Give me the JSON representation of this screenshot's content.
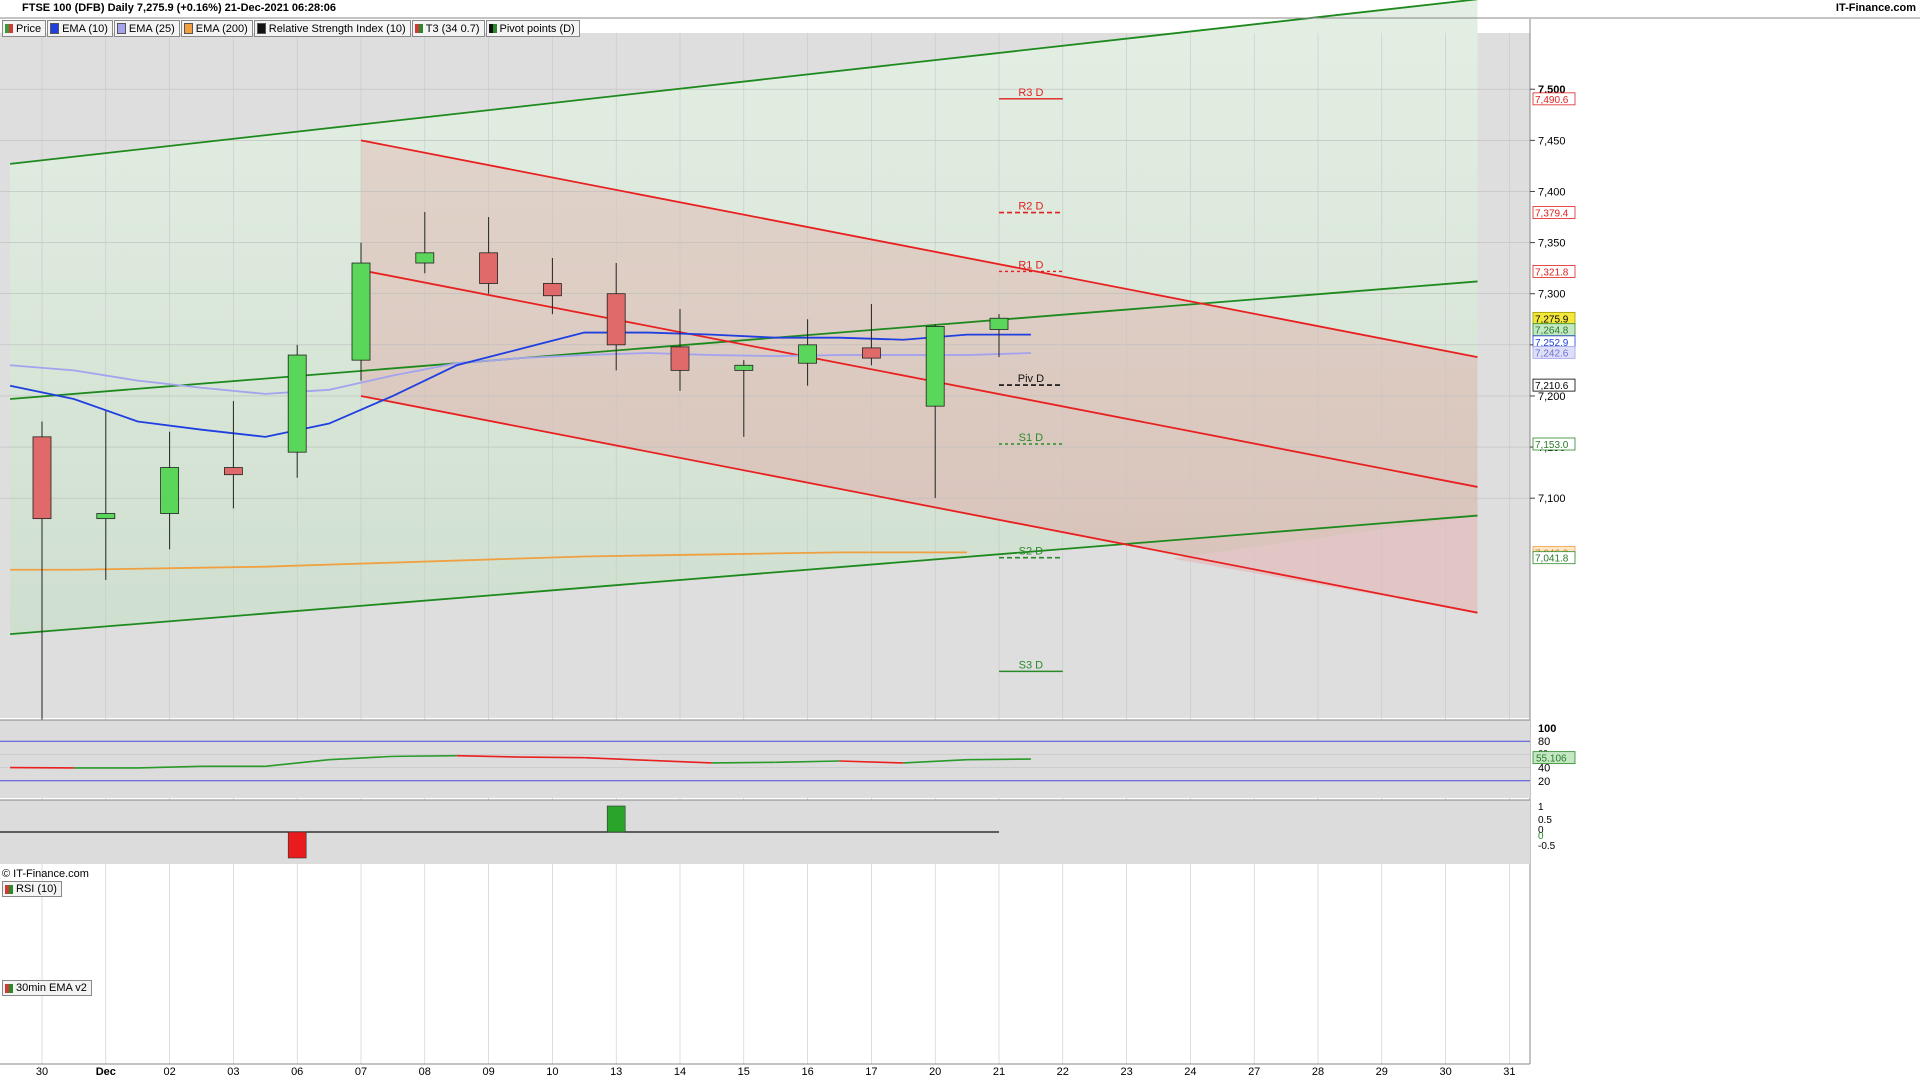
{
  "header": {
    "title": "FTSE 100 (DFB) Daily 7,275.9 (+0.16%) 21-Dec-2021 06:28:06",
    "brand": "IT-Finance.com"
  },
  "legend": [
    {
      "label": "Price",
      "color": "#3a9a3a",
      "color2": "#d23a3a"
    },
    {
      "label": "EMA (10)",
      "color": "#1f3fe0"
    },
    {
      "label": "EMA (25)",
      "color": "#a3a3ee"
    },
    {
      "label": "EMA (200)",
      "color": "#f0a040"
    },
    {
      "label": "Relative Strength Index (10)",
      "color": "#111111"
    },
    {
      "label": "T3 (34 0.7)",
      "color": "#d23a3a",
      "color2": "#2a8a2a"
    },
    {
      "label": "Pivot points (D)",
      "color": "#111111",
      "color2": "#2a8a2a"
    }
  ],
  "copyright": "© IT-Finance.com",
  "rsi_pane_label": "RSI (10)",
  "ema_pane_label": "30min EMA v2",
  "chart_data": {
    "type": "candlestick",
    "dates": [
      "30",
      "Dec",
      "02",
      "03",
      "06",
      "07",
      "08",
      "09",
      "10",
      "13",
      "14",
      "15",
      "16",
      "17",
      "20",
      "21",
      "22",
      "23",
      "24",
      "27",
      "28",
      "29",
      "30",
      "31"
    ],
    "candles": [
      {
        "date": "30",
        "open": 7160,
        "high": 7175,
        "low": 6860,
        "close": 7080
      },
      {
        "date": "Dec",
        "open": 7080,
        "high": 7185,
        "low": 7020,
        "close": 7085
      },
      {
        "date": "02",
        "open": 7085,
        "high": 7165,
        "low": 7050,
        "close": 7130
      },
      {
        "date": "03",
        "open": 7130,
        "high": 7195,
        "low": 7090,
        "close": 7123
      },
      {
        "date": "06",
        "open": 7145,
        "high": 7250,
        "low": 7120,
        "close": 7240
      },
      {
        "date": "07",
        "open": 7235,
        "high": 7350,
        "low": 7215,
        "close": 7330
      },
      {
        "date": "08",
        "open": 7330,
        "high": 7380,
        "low": 7320,
        "close": 7340
      },
      {
        "date": "09",
        "open": 7340,
        "high": 7375,
        "low": 7300,
        "close": 7310
      },
      {
        "date": "10",
        "open": 7310,
        "high": 7335,
        "low": 7280,
        "close": 7298
      },
      {
        "date": "13",
        "open": 7300,
        "high": 7330,
        "low": 7225,
        "close": 7250
      },
      {
        "date": "14",
        "open": 7248,
        "high": 7285,
        "low": 7205,
        "close": 7225
      },
      {
        "date": "15",
        "open": 7225,
        "high": 7235,
        "low": 7160,
        "close": 7230
      },
      {
        "date": "16",
        "open": 7232,
        "high": 7275,
        "low": 7210,
        "close": 7250
      },
      {
        "date": "17",
        "open": 7247,
        "high": 7290,
        "low": 7230,
        "close": 7237
      },
      {
        "date": "20",
        "open": 7190,
        "high": 7270,
        "low": 7100,
        "close": 7268
      },
      {
        "date": "21",
        "open": 7265,
        "high": 7280,
        "low": 7238,
        "close": 7276
      }
    ],
    "ema10": [
      7210,
      7197,
      7175,
      7167,
      7160,
      7173,
      7200,
      7230,
      7246,
      7262,
      7262,
      7260,
      7257,
      7257,
      7255,
      7260,
      7260
    ],
    "ema25": [
      7230,
      7225,
      7215,
      7208,
      7202,
      7206,
      7220,
      7232,
      7237,
      7240,
      7242,
      7240,
      7239,
      7240,
      7240,
      7240,
      7242
    ],
    "ema200": [
      7030,
      7030,
      7031,
      7032,
      7033,
      7035,
      7037,
      7039,
      7041,
      7043,
      7044,
      7045,
      7046,
      7047,
      7047,
      7047
    ],
    "channels": {
      "green_upper": [
        [
          -0.5,
          7427
        ],
        [
          22.5,
          7588
        ]
      ],
      "green_mid": [
        [
          -0.5,
          7197
        ],
        [
          22.5,
          7312
        ]
      ],
      "green_lower": [
        [
          -0.5,
          6967
        ],
        [
          22.5,
          7083
        ]
      ],
      "red_upper": [
        [
          5,
          7450
        ],
        [
          22.5,
          7238
        ]
      ],
      "red_mid": [
        [
          5,
          7323
        ],
        [
          22.5,
          7111
        ]
      ],
      "red_lower": [
        [
          5,
          7200
        ],
        [
          22.5,
          6988
        ]
      ]
    },
    "pivots": [
      {
        "label": "R3 D",
        "value": 7490.6,
        "color": "#e02020",
        "style": "solid"
      },
      {
        "label": "R2 D",
        "value": 7379.4,
        "color": "#e02020",
        "style": "dashed"
      },
      {
        "label": "R1 D",
        "value": 7321.8,
        "color": "#e02020",
        "style": "dotted"
      },
      {
        "label": "Piv D",
        "value": 7210.6,
        "color": "#111111",
        "style": "dashed"
      },
      {
        "label": "S1 D",
        "value": 7153.0,
        "color": "#2a8a2a",
        "style": "dotted"
      },
      {
        "label": "S2 D",
        "value": 7041.8,
        "color": "#2a8a2a",
        "style": "dashed"
      },
      {
        "label": "S3 D",
        "value": 6930.6,
        "color": "#2a8a2a",
        "style": "solid"
      }
    ],
    "y_axis": {
      "ylim": [
        6885,
        7555
      ],
      "ticks": [
        7100,
        7150,
        7200,
        7250,
        7300,
        7350,
        7400,
        7450,
        7500
      ],
      "tick_labels": [
        "7,100",
        "7,150",
        "7,200",
        "7,250",
        "7,300",
        "7,350",
        "7,400",
        "7,450",
        "7,500"
      ]
    },
    "price_tags": [
      {
        "value": 7490.6,
        "label": "7,490.6",
        "bg": "#ffffff",
        "fg": "#e02020",
        "border": "#e02020"
      },
      {
        "value": 7379.4,
        "label": "7,379.4",
        "bg": "#ffffff",
        "fg": "#e02020",
        "border": "#e02020"
      },
      {
        "value": 7321.8,
        "label": "7,321.8",
        "bg": "#ffffff",
        "fg": "#e02020",
        "border": "#e02020"
      },
      {
        "value": 7275.9,
        "label": "7,275.9",
        "bg": "#f4e83c",
        "fg": "#000000",
        "border": "#999900"
      },
      {
        "value": 7264.8,
        "label": "7,264.8",
        "bg": "#c4e8c4",
        "fg": "#2a7a2a",
        "border": "#2a8a2a"
      },
      {
        "value": 7252.9,
        "label": "7,252.9",
        "bg": "#ffffff",
        "fg": "#1f3fe0",
        "border": "#1f3fe0"
      },
      {
        "value": 7242.6,
        "label": "7,242.6",
        "bg": "#dddff8",
        "fg": "#7070d0",
        "border": "#a3a3ee"
      },
      {
        "value": 7210.6,
        "label": "7,210.6",
        "bg": "#ffffff",
        "fg": "#000000",
        "border": "#000000"
      },
      {
        "value": 7153.0,
        "label": "7,153.0",
        "bg": "#ffffff",
        "fg": "#2a7a2a",
        "border": "#2a8a2a"
      },
      {
        "value": 7046.9,
        "label": "7,046.9",
        "bg": "#fde6c8",
        "fg": "#d08020",
        "border": "#f0a040"
      },
      {
        "value": 7041.8,
        "label": "7,041.8",
        "bg": "#ffffff",
        "fg": "#2a7a2a",
        "border": "#2a8a2a"
      }
    ],
    "rsi": {
      "values": [
        40,
        39.5,
        39.5,
        42,
        42,
        52,
        57,
        58,
        56,
        55,
        51,
        47,
        48,
        50,
        47,
        52,
        53
      ],
      "ylim": [
        0,
        100
      ],
      "ticks": [
        20,
        40,
        80,
        100
      ],
      "tick_labels": [
        "20",
        "40",
        "80",
        "100"
      ],
      "hidden_tick": "60",
      "current": "55.106"
    },
    "ema_v2": {
      "bars": [
        {
          "index": 4,
          "value": -1
        },
        {
          "index": 9,
          "value": 1
        }
      ],
      "ylim": [
        -1,
        1
      ],
      "tick_labels": [
        "1",
        "0.5",
        "0",
        "0",
        "-0.5"
      ]
    }
  }
}
